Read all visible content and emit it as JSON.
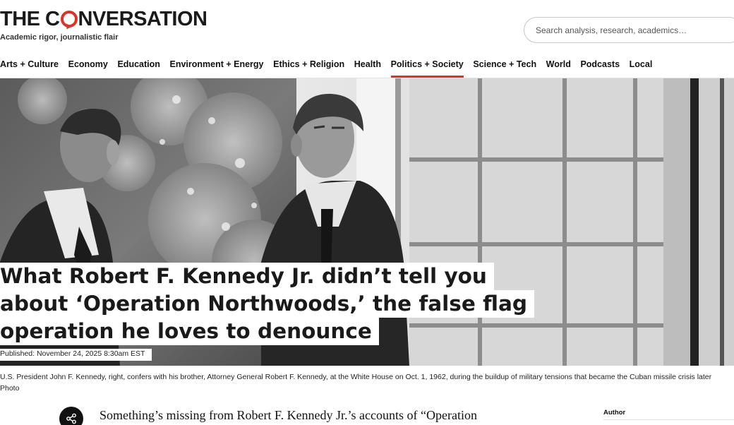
{
  "site": {
    "logo_pre": "THE C",
    "logo_post": "NVERSATION",
    "tagline": "Academic rigor, journalistic flair"
  },
  "search": {
    "placeholder": "Search analysis, research, academics…"
  },
  "nav": {
    "items": [
      {
        "label": "Arts + Culture"
      },
      {
        "label": "Economy"
      },
      {
        "label": "Education"
      },
      {
        "label": "Environment + Energy"
      },
      {
        "label": "Ethics + Religion"
      },
      {
        "label": "Health"
      },
      {
        "label": "Politics + Society",
        "active": true
      },
      {
        "label": "Science + Tech"
      },
      {
        "label": "World"
      },
      {
        "label": "Podcasts"
      },
      {
        "label": "Local"
      }
    ]
  },
  "article": {
    "headline_lines": [
      "What Robert F. Kennedy Jr. didn’t tell you",
      "about ‘Operation Northwoods,’ the false flag",
      "operation he loves to denounce"
    ],
    "published": "Published: November 24, 2025 8:30am EST",
    "caption_line1": "U.S. President John F. Kennedy, right, confers with his brother, Attorney General Robert F. Kennedy, at the White House on Oct. 1, 1962, during the buildup of military tensions that became the Cuban missile crisis later",
    "caption_line2": "Photo",
    "lead": "Something’s missing from Robert F. Kennedy Jr.’s accounts of “Operation"
  },
  "sidebar": {
    "author_label": "Author"
  },
  "icons": {
    "share": "share-icon"
  },
  "colors": {
    "accent": "#d8352a"
  }
}
